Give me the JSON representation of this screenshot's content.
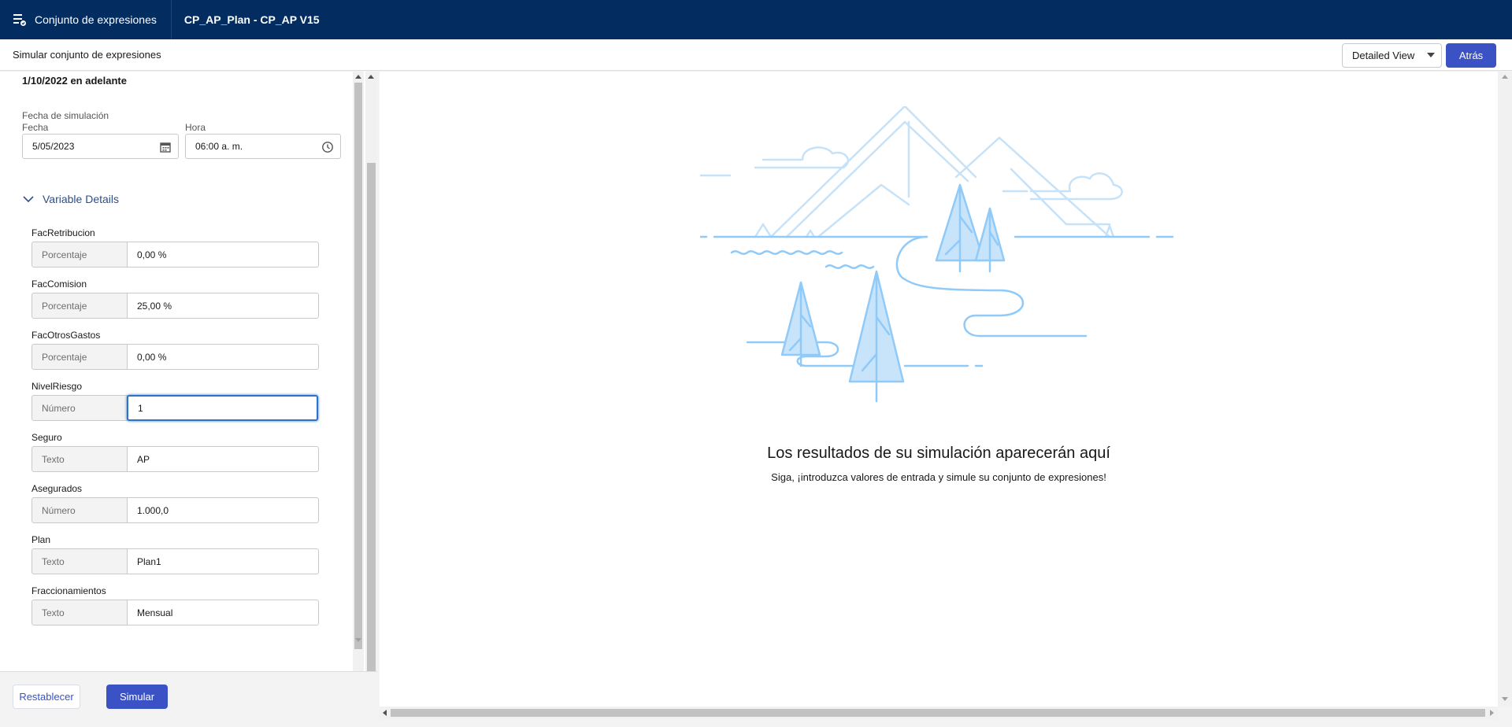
{
  "topbar": {
    "app_name": "Conjunto de expresiones",
    "document_title": "CP_AP_Plan - CP_AP V15"
  },
  "subbar": {
    "title": "Simular conjunto de expresiones",
    "view_select": "Detailed View",
    "back_label": "Atrás"
  },
  "left": {
    "date_range": "1/10/2022  en adelante",
    "sim_date_label": "Fecha de simulación",
    "date_caption": "Fecha",
    "date_value": "5/05/2023",
    "time_caption": "Hora",
    "time_value": "06:00 a. m.",
    "section_label": "Variable Details",
    "variables": [
      {
        "name": "FacRetribucion",
        "type": "Porcentaje",
        "value": "0,00 %"
      },
      {
        "name": "FacComision",
        "type": "Porcentaje",
        "value": "25,00 %"
      },
      {
        "name": "FacOtrosGastos",
        "type": "Porcentaje",
        "value": "0,00 %"
      },
      {
        "name": "NivelRiesgo",
        "type": "Número",
        "value": "1"
      },
      {
        "name": "Seguro",
        "type": "Texto",
        "value": "AP"
      },
      {
        "name": "Asegurados",
        "type": "Número",
        "value": "1.000,0"
      },
      {
        "name": "Plan",
        "type": "Texto",
        "value": "Plan1"
      },
      {
        "name": "Fraccionamientos",
        "type": "Texto",
        "value": "Mensual"
      }
    ],
    "reset_label": "Restablecer",
    "simulate_label": "Simular"
  },
  "right": {
    "empty_title": "Los resultados de su simulación aparecerán aquí",
    "empty_subtitle": "Siga, ¡introduzca valores de entrada y simule su conjunto de expresiones!"
  },
  "colors": {
    "header_bg": "#032d60",
    "brand_button": "#3a52c4",
    "illustration_stroke": "#90caf9",
    "illustration_fill": "#c8e4fb"
  }
}
